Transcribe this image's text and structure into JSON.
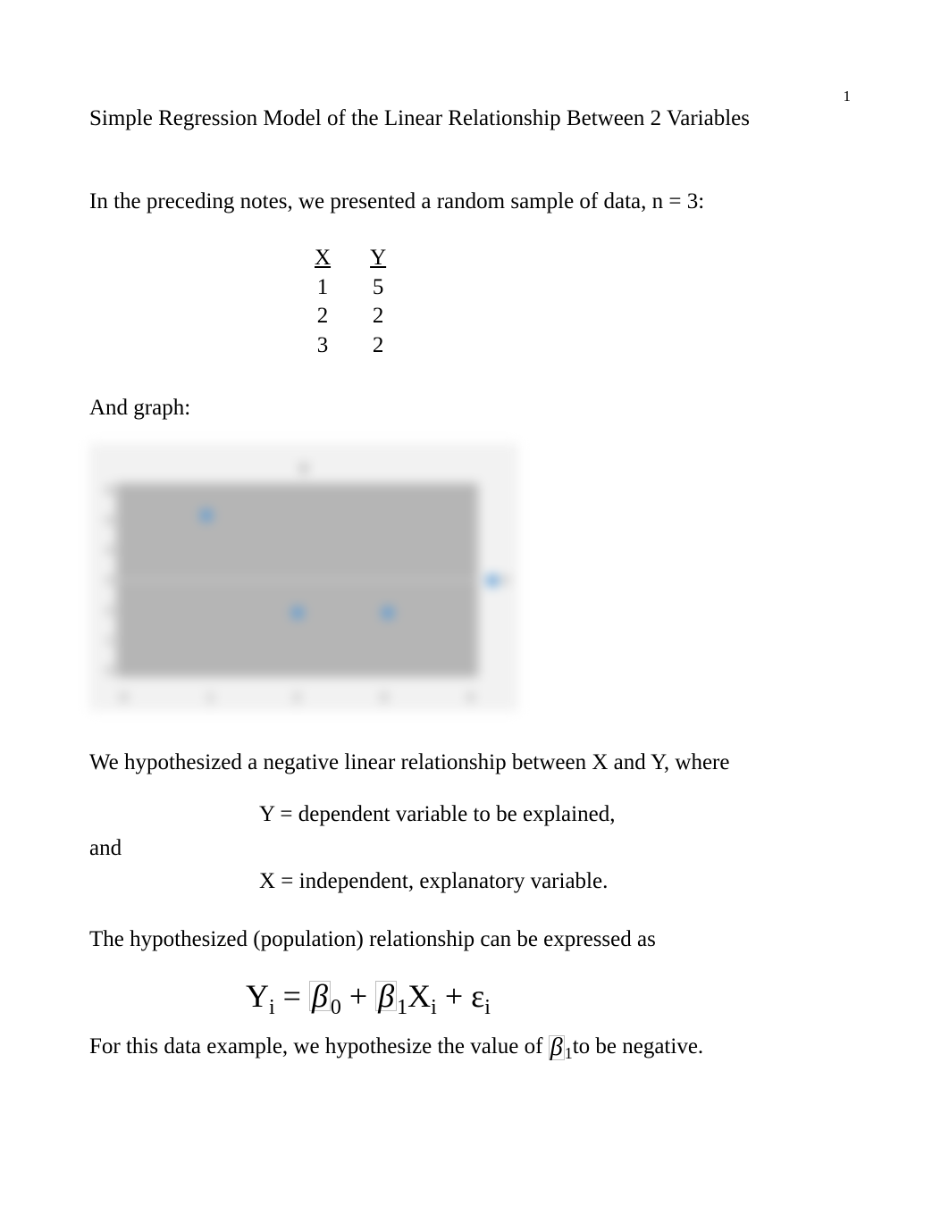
{
  "page_number": "1",
  "title": "Simple Regression Model of the Linear Relationship Between 2 Variables",
  "intro": "In the preceding notes, we presented a random sample of data, n = 3:",
  "table": {
    "header_x": "X",
    "header_y": "Y",
    "rows": [
      {
        "x": "1",
        "y": "5"
      },
      {
        "x": "2",
        "y": "2"
      },
      {
        "x": "3",
        "y": "2"
      }
    ]
  },
  "graph_label": "And graph:",
  "chart_data": {
    "type": "scatter",
    "title": "Y",
    "xlabel": "",
    "ylabel": "",
    "x_ticks": [
      "0",
      "1",
      "2",
      "3",
      "4"
    ],
    "y_ticks": [
      "0",
      "1",
      "2",
      "3",
      "4",
      "5",
      "6"
    ],
    "xlim": [
      0,
      4
    ],
    "ylim": [
      0,
      6
    ],
    "series": [
      {
        "name": "Y",
        "x": [
          1,
          2,
          3
        ],
        "y": [
          5,
          2,
          2
        ]
      }
    ],
    "legend_position": "right"
  },
  "hypothesis_line": "We hypothesized a negative linear relationship between X and Y, where",
  "y_def": "Y = dependent variable to be explained,",
  "and_text": "and",
  "x_def": "X = independent, explanatory variable.",
  "relationship_line": "The hypothesized (population) relationship can be expressed as",
  "equation": {
    "Y": "Y",
    "i": "i",
    "eq": " = ",
    "b0": "β",
    "s0": "0",
    "plus1": " +  ",
    "b1": "β",
    "s1": "1",
    "X": "X",
    "xi": "i",
    "plus2": " + ",
    "eps": "ε",
    "ei": "i"
  },
  "final_prefix": "For this data example, we hypothesize the value of ",
  "final_beta": "β",
  "final_sub": "1",
  "final_suffix": "to be negative."
}
